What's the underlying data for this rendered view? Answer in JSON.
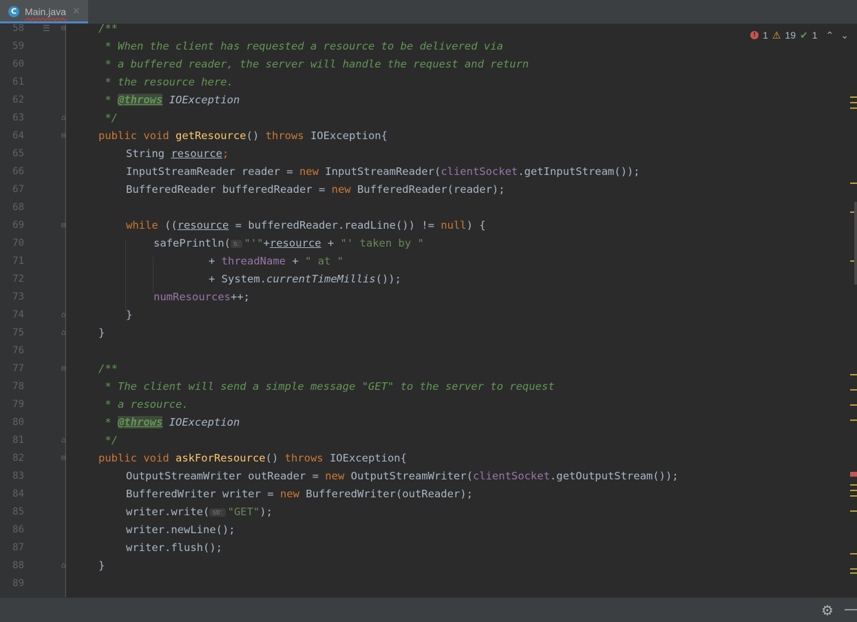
{
  "tab": {
    "icon": "C",
    "label": "Main.java",
    "close": "×"
  },
  "inspection": {
    "errors": "1",
    "warnings": "19",
    "weak_warnings": "1"
  },
  "lines": [
    {
      "n": "58",
      "t": "/**"
    },
    {
      "n": "59",
      "t": " * When the client has requested a resource to be delivered via"
    },
    {
      "n": "60",
      "t": " * a buffered reader, the server will handle the request and return"
    },
    {
      "n": "61",
      "t": " * the resource here."
    },
    {
      "n": "62",
      "a": " * ",
      "b": "@throws",
      "c": " IOException"
    },
    {
      "n": "63",
      "t": " */"
    },
    {
      "n": "64",
      "a": "public void ",
      "b": "getResource",
      "c": "() ",
      "d": "throws",
      "e": " IOException{"
    },
    {
      "n": "65",
      "a": "String ",
      "b": "resource",
      "c": ";"
    },
    {
      "n": "66",
      "a": "InputStreamReader reader = ",
      "b": "new",
      "c": " InputStreamReader(",
      "d": "clientSocket",
      "e": ".getInputStream());"
    },
    {
      "n": "67",
      "a": "BufferedReader bufferedReader = ",
      "b": "new",
      "c": " BufferedReader(reader);"
    },
    {
      "n": "68",
      "t": ""
    },
    {
      "n": "69",
      "a": "while",
      "b": " ((",
      "c": "resource",
      "d": " = bufferedReader.readLine()) != ",
      "e": "null",
      "f": ") {"
    },
    {
      "n": "70",
      "a": "safePrintln(",
      "h": "s:",
      "b": "\"'\"",
      "c": "+",
      "d": "resource",
      "e": " + ",
      "f": "\"' taken by \""
    },
    {
      "n": "71",
      "a": "+ ",
      "b": "threadName",
      "c": " + ",
      "d": "\" at \""
    },
    {
      "n": "72",
      "a": "+ System.",
      "b": "currentTimeMillis",
      "c": "());"
    },
    {
      "n": "73",
      "a": "numResources",
      "b": "++;"
    },
    {
      "n": "74",
      "t": "}"
    },
    {
      "n": "75",
      "t": "}"
    },
    {
      "n": "76",
      "t": ""
    },
    {
      "n": "77",
      "t": "/**"
    },
    {
      "n": "78",
      "t": " * The client will send a simple message \"GET\" to the server to request"
    },
    {
      "n": "79",
      "t": " * a resource."
    },
    {
      "n": "80",
      "a": " * ",
      "b": "@throws",
      "c": " IOException"
    },
    {
      "n": "81",
      "t": " */"
    },
    {
      "n": "82",
      "a": "public void ",
      "b": "askForResource",
      "c": "() ",
      "d": "throws",
      "e": " IOException{"
    },
    {
      "n": "83",
      "a": "OutputStreamWriter outReader = ",
      "b": "new",
      "c": " OutputStreamWriter(",
      "d": "clientSocket",
      "e": ".getOutputStream());"
    },
    {
      "n": "84",
      "a": "BufferedWriter writer = ",
      "b": "new",
      "c": " BufferedWriter(outReader);"
    },
    {
      "n": "85",
      "a": "writer.write(",
      "h": "str:",
      "b": "\"GET\"",
      "c": ");"
    },
    {
      "n": "86",
      "t": "writer.newLine();"
    },
    {
      "n": "87",
      "t": "writer.flush();"
    },
    {
      "n": "88",
      "t": "}"
    },
    {
      "n": "89",
      "t": ""
    }
  ],
  "icons": [
    "gear-icon",
    "hide-panel-icon",
    "error-icon",
    "warning-icon",
    "check-icon",
    "chevron-up-icon",
    "chevron-down-icon",
    "fold-icon"
  ],
  "colors": {
    "background": "#2b2b2b",
    "keyword": "#cc7832",
    "method": "#ffc66d",
    "comment": "#629755",
    "string": "#6a8759",
    "field": "#9876aa",
    "tab_accent": "#4a88c7"
  }
}
